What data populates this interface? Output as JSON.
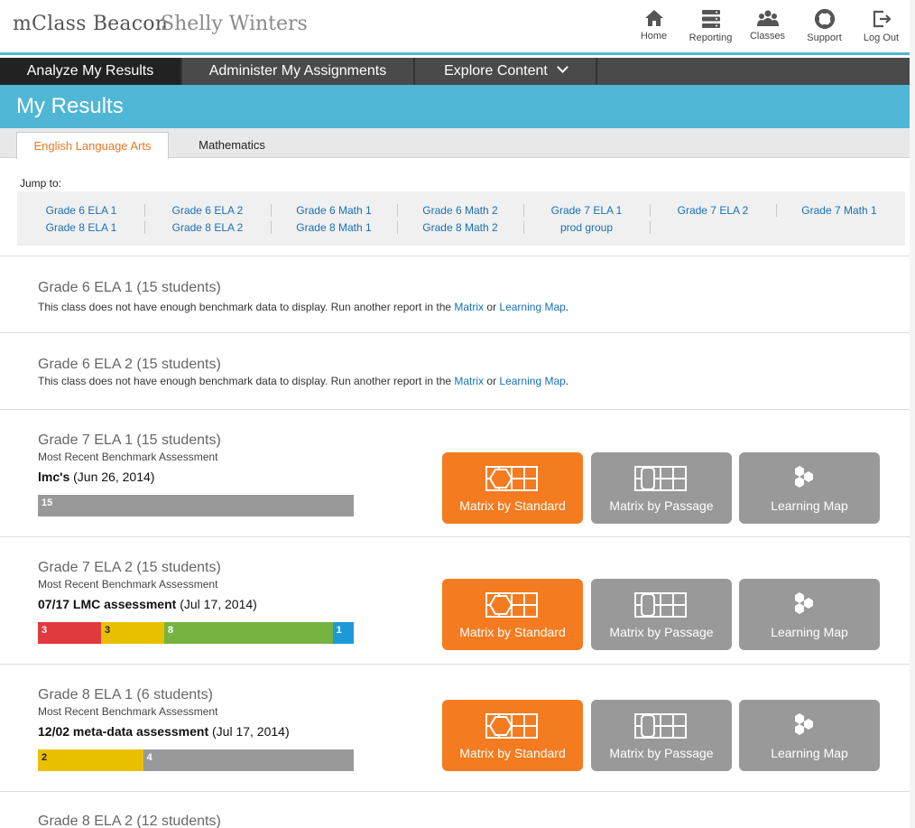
{
  "header": {
    "brand": "mClass Beacon",
    "user": "Shelly Winters",
    "nav": [
      {
        "label": "Home",
        "icon": "home-icon"
      },
      {
        "label": "Reporting",
        "icon": "reporting-icon"
      },
      {
        "label": "Classes",
        "icon": "classes-icon"
      },
      {
        "label": "Support",
        "icon": "support-icon"
      },
      {
        "label": "Log Out",
        "icon": "logout-icon"
      }
    ]
  },
  "main_nav": [
    {
      "label": "Analyze My Results",
      "active": true
    },
    {
      "label": "Administer My Assignments",
      "active": false
    },
    {
      "label": "Explore Content",
      "active": false,
      "dropdown": true
    }
  ],
  "page_title": "My Results",
  "subject_tabs": [
    {
      "label": "English Language Arts",
      "active": true
    },
    {
      "label": "Mathematics",
      "active": false
    }
  ],
  "jump": {
    "label": "Jump to:",
    "row1": [
      "Grade 6 ELA 1",
      "Grade 6 ELA 2",
      "Grade 6 Math 1",
      "Grade 6 Math 2",
      "Grade 7 ELA 1",
      "Grade 7 ELA 2",
      "Grade 7 Math 1"
    ],
    "row2": [
      "Grade 8 ELA 1",
      "Grade 8 ELA 2",
      "Grade 8 Math 1",
      "Grade 8 Math 2",
      "prod group"
    ]
  },
  "sections": [
    {
      "title": "Grade 6 ELA 1 (15 students)",
      "message": {
        "text": "This class does not have enough benchmark data to display. Run another report in the ",
        "link1": "Matrix",
        "or": " or ",
        "link2": "Learning Map",
        "end": "."
      }
    },
    {
      "title": "Grade 6 ELA 2 (15 students)",
      "message": {
        "text": "This class does not have enough benchmark data to display. Run another report in the ",
        "link1": "Matrix",
        "or": " or ",
        "link2": "Learning Map",
        "end": "."
      }
    },
    {
      "title": "Grade 7 ELA 1 (15 students)",
      "recent_label": "Most Recent Benchmark Assessment",
      "assessment_name": "lmc's",
      "assessment_date": "(Jun 26, 2014)",
      "bar": [
        {
          "count": "15",
          "color": "#999999"
        }
      ]
    },
    {
      "title": "Grade 7 ELA 2 (15 students)",
      "recent_label": "Most Recent Benchmark Assessment",
      "assessment_name": "07/17 LMC assessment",
      "assessment_date": "(Jul 17, 2014)",
      "bar": [
        {
          "count": "3",
          "color": "#e03a3e"
        },
        {
          "count": "3",
          "color": "#e8c000"
        },
        {
          "count": "8",
          "color": "#76b341"
        },
        {
          "count": "1",
          "color": "#1d9ad6"
        }
      ]
    },
    {
      "title": "Grade 8 ELA 1 (6 students)",
      "recent_label": "Most Recent Benchmark Assessment",
      "assessment_name": "12/02 meta-data assessment",
      "assessment_date": "(Jul 17, 2014)",
      "bar": [
        {
          "count": "2",
          "color": "#e8c000"
        },
        {
          "count": "4",
          "color": "#999999"
        }
      ]
    },
    {
      "title": "Grade 8 ELA 2 (12 students)"
    }
  ],
  "buttons": {
    "matrix_standard": "Matrix by Standard",
    "matrix_passage": "Matrix by Passage",
    "learning_map": "Learning Map"
  },
  "colors": {
    "accent_blue": "#4fb7d5",
    "orange": "#f47b20",
    "grey_button": "#999999",
    "link": "#1a6fb5"
  }
}
